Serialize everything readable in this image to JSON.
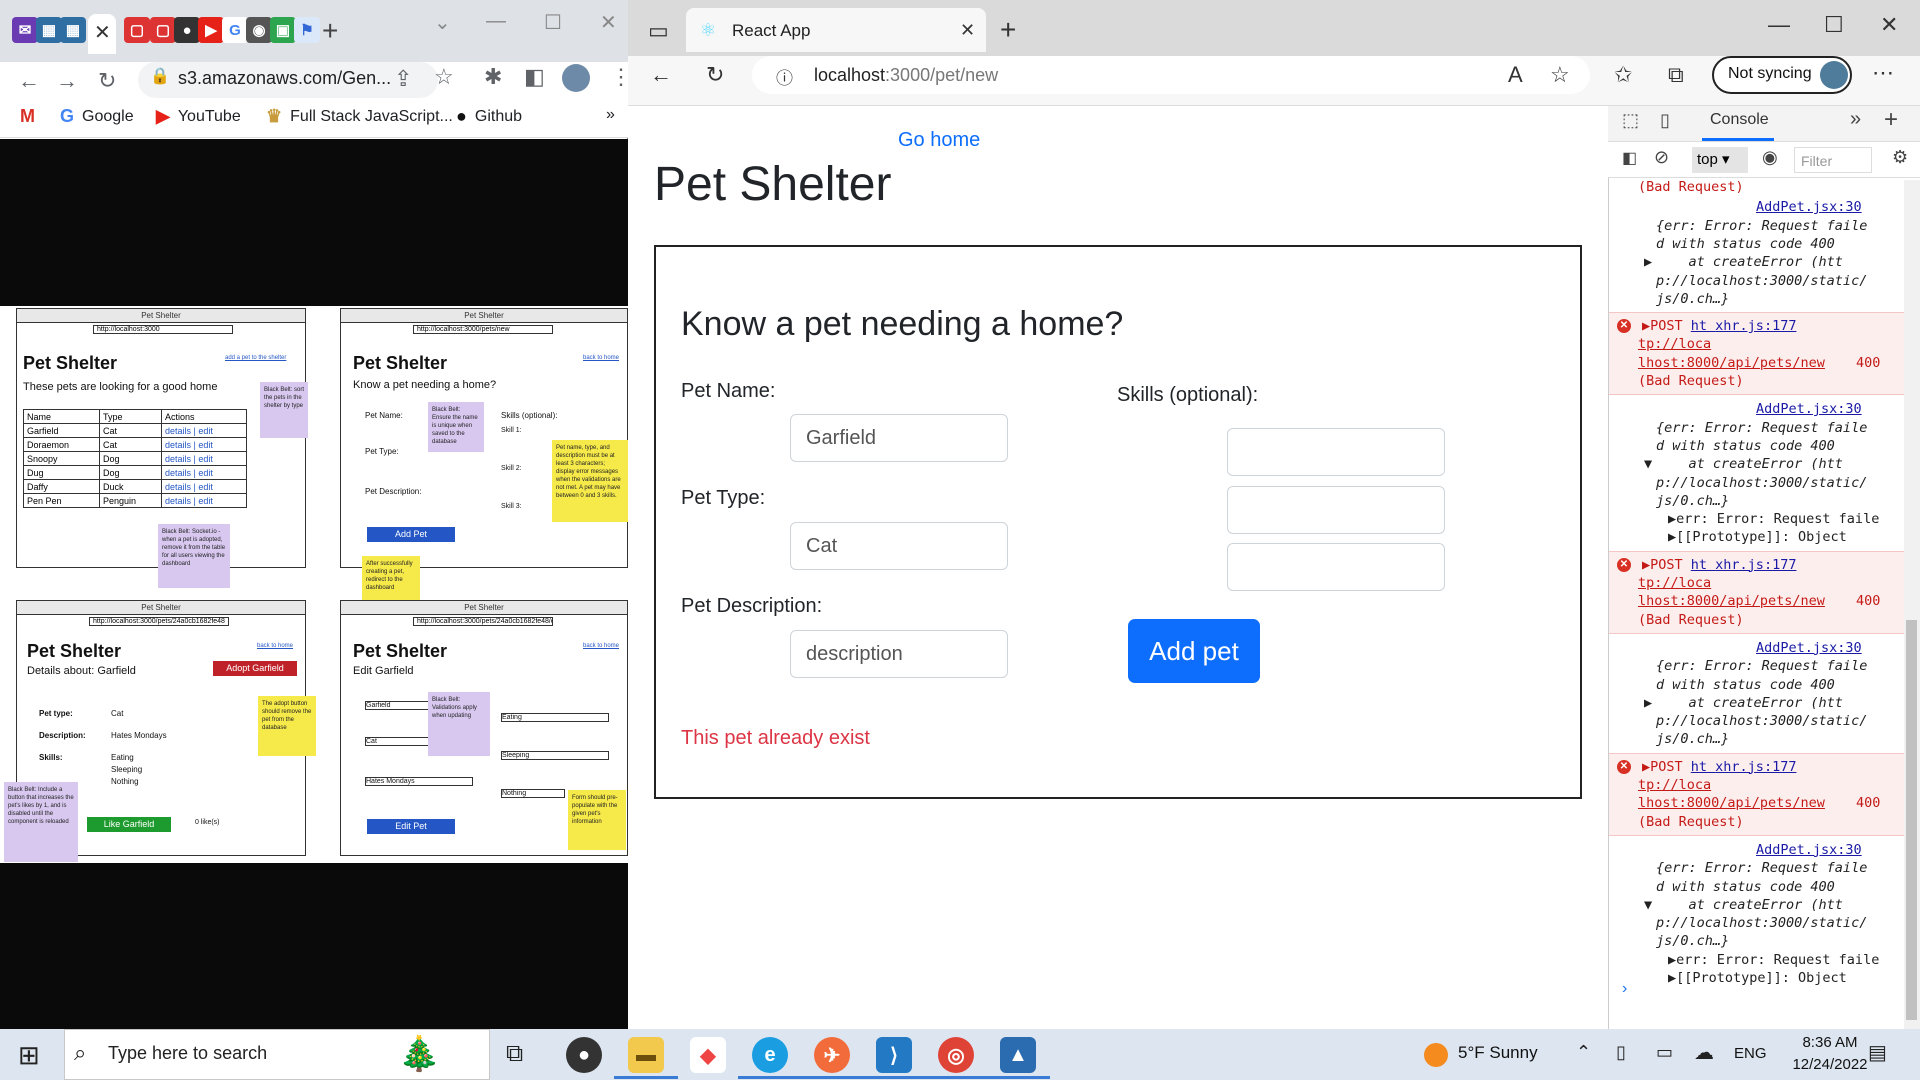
{
  "left_browser": {
    "url": "s3.amazonaws.com/Gen...",
    "bookmarks": [
      "Google",
      "YouTube",
      "Full Stack JavaScript...",
      "Github"
    ],
    "wireframe": {
      "browser_title": "Pet Shelter",
      "panel1": {
        "url": "http://localhost:3000",
        "title": "Pet Shelter",
        "subtitle": "These pets are looking for a good home",
        "link": "add a pet to the shelter",
        "table_headers": [
          "Name",
          "Type",
          "Actions"
        ],
        "rows": [
          [
            "Garfield",
            "Cat",
            "details | edit"
          ],
          [
            "Doraemon",
            "Cat",
            "details | edit"
          ],
          [
            "Snoopy",
            "Dog",
            "details | edit"
          ],
          [
            "Dug",
            "Dog",
            "details | edit"
          ],
          [
            "Daffy",
            "Duck",
            "details | edit"
          ],
          [
            "Pen Pen",
            "Penguin",
            "details | edit"
          ]
        ],
        "note": "Black Belt: sort the pets in the shelter by type"
      },
      "panel2": {
        "url": "http://localhost:3000/pets/new",
        "title": "Pet Shelter",
        "subtitle": "Know a pet needing a home?",
        "link": "back to home",
        "labels": [
          "Pet Name:",
          "Pet Type:",
          "Pet Description:",
          "Skills (optional):",
          "Skill 1:",
          "Skill 2:",
          "Skill 3:"
        ],
        "button": "Add Pet",
        "note_purple": "Black Belt: Ensure the name is unique when saved to the database",
        "note_yellow": "Pet name, type, and description must be at least 3 characters; display error messages when the validations are not met. A pet may have between 0 and 3 skills."
      },
      "panel3": {
        "url": "http://localhost:3000/pets/24a0cb1682fe48",
        "title": "Pet Shelter",
        "subtitle": "Details about: Garfield",
        "link": "back to home",
        "adopt": "Adopt Garfield",
        "fields": [
          [
            "Pet type:",
            "Cat"
          ],
          [
            "Description:",
            "Hates Mondays"
          ],
          [
            "Skills:",
            "Eating"
          ]
        ],
        "skills_extra": [
          "Sleeping",
          "Nothing"
        ],
        "like": "Like Garfield",
        "likes": "0 like(s)",
        "note_yellow": "The adopt button should remove the pet from the database",
        "note_purple": "Black Belt: Include a button that increases the pet's likes by 1, and is disabled until the component is reloaded"
      },
      "panel4": {
        "url": "http://localhost:3000/pets/24a0cb1682fe48/edit",
        "title": "Pet Shelter",
        "subtitle": "Edit Garfield",
        "link": "back to home",
        "values": [
          "Garfield",
          "Cat",
          "Hates Mondays",
          "Eating",
          "Sleeping",
          "Nothing"
        ],
        "button": "Edit Pet",
        "note_purple": "Black Belt: Validations apply when updating",
        "note_yellow": "Form should pre-populate with the given pet's information"
      },
      "center_note_purple": "Black Belt: Socket.io - when a pet is adopted, remove it from the table for all users viewing the dashboard",
      "center_note_yellow": "After successfully creating a pet, redirect to the dashboard"
    }
  },
  "edge": {
    "tab_title": "React App",
    "url_host": "localhost",
    "url_path": ":3000/pet/new",
    "sync_label": "Not syncing",
    "page": {
      "go_home": "Go home",
      "title": "Pet Shelter",
      "form_title": "Know a pet needing a home?",
      "name_label": "Pet Name:",
      "name_value": "Garfield",
      "type_label": "Pet Type:",
      "type_value": "Cat",
      "desc_label": "Pet Description:",
      "desc_value": "description",
      "skills_label": "Skills (optional):",
      "skill_values": [
        "",
        "",
        ""
      ],
      "submit": "Add pet",
      "error": "This pet already exist"
    },
    "devtools": {
      "tab": "Console",
      "context": "top",
      "filter_placeholder": "Filter",
      "first_line": "(Bad Request)",
      "entries": [
        {
          "kind": "log",
          "src": "AddPet.jsx:30",
          "lines": [
            "{err: Error: Request faile",
            "d with status code 400",
            "    at createError (htt",
            "p://localhost:3000/static/",
            "js/0.ch…}"
          ],
          "expanded": false
        },
        {
          "kind": "error",
          "method": "POST",
          "prefix": "ht",
          "src": "xhr.js:177",
          "lines": [
            "tp://loca",
            "lhost:8000/api/pets/new",
            "(Bad Request)"
          ],
          "status": "400"
        },
        {
          "kind": "log",
          "src": "AddPet.jsx:30",
          "lines": [
            "{err: Error: Request faile",
            "d with status code 400",
            "    at createError (htt",
            "p://localhost:3000/static/",
            "js/0.ch…}"
          ],
          "expanded": true,
          "children": [
            "err: Error: Request faile",
            "[[Prototype]]: Object"
          ]
        },
        {
          "kind": "error",
          "method": "POST",
          "prefix": "ht",
          "src": "xhr.js:177",
          "lines": [
            "tp://loca",
            "lhost:8000/api/pets/new",
            "(Bad Request)"
          ],
          "status": "400"
        },
        {
          "kind": "log",
          "src": "AddPet.jsx:30",
          "lines": [
            "{err: Error: Request faile",
            "d with status code 400",
            "    at createError (htt",
            "p://localhost:3000/static/",
            "js/0.ch…}"
          ],
          "expanded": false
        },
        {
          "kind": "error",
          "method": "POST",
          "prefix": "ht",
          "src": "xhr.js:177",
          "lines": [
            "tp://loca",
            "lhost:8000/api/pets/new",
            "(Bad Request)"
          ],
          "status": "400"
        },
        {
          "kind": "log",
          "src": "AddPet.jsx:30",
          "lines": [
            "{err: Error: Request faile",
            "d with status code 400",
            "    at createError (htt",
            "p://localhost:3000/static/",
            "js/0.ch…}"
          ],
          "expanded": true,
          "children": [
            "err: Error: Request faile",
            "[[Prototype]]: Object"
          ]
        }
      ]
    }
  },
  "taskbar": {
    "search_placeholder": "Type here to search",
    "weather": "5°F  Sunny",
    "language": "ENG",
    "time": "8:36 AM",
    "date": "12/24/2022"
  }
}
